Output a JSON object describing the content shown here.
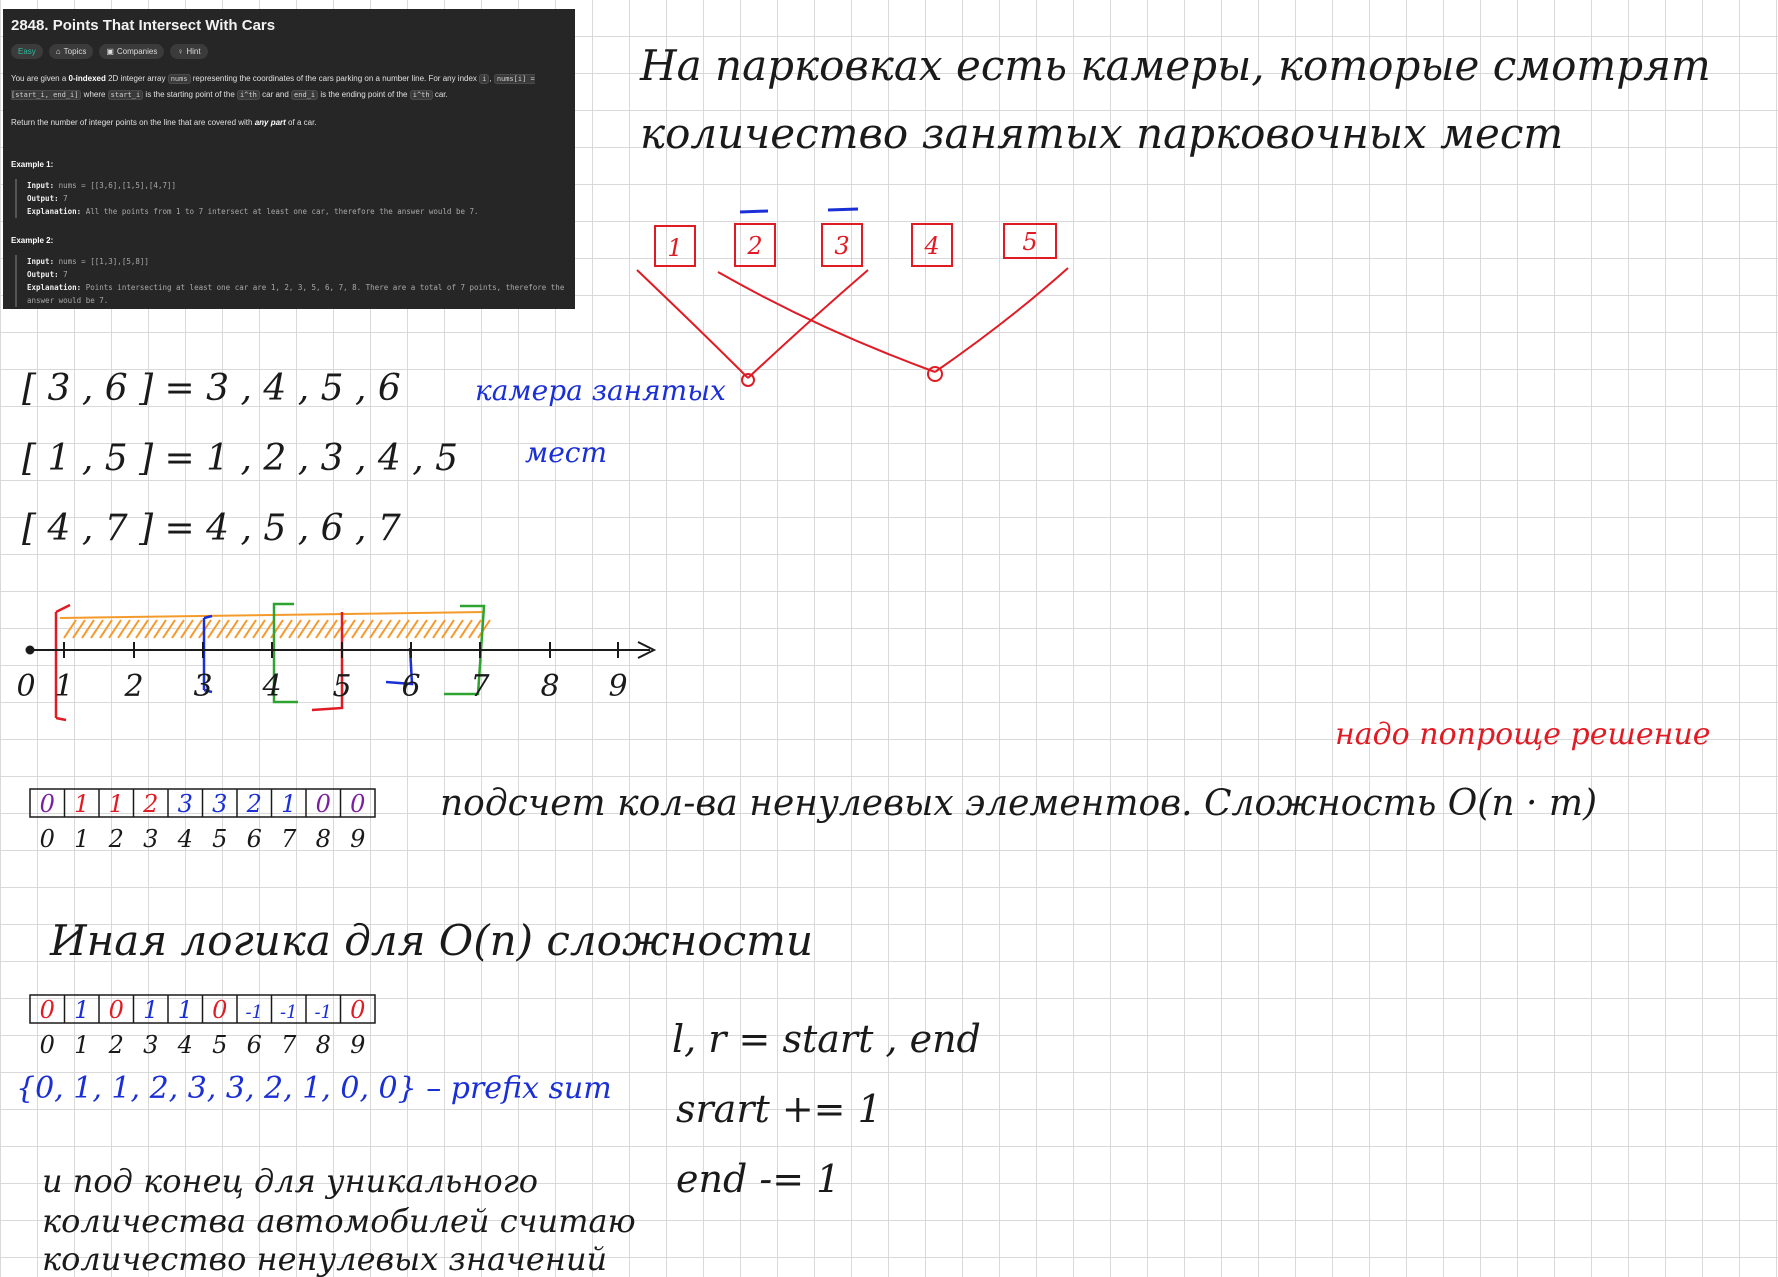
{
  "problem": {
    "title": "2848. Points That Intersect With Cars",
    "tags": [
      "Easy",
      "Topics",
      "Companies",
      "Hint"
    ],
    "desc1_a": "You are given a ",
    "desc1_b": "0-indexed",
    "desc1_c": " 2D integer array ",
    "desc1_code": "nums",
    "desc1_d": " representing the coordinates of the cars parking on a number line. For any index ",
    "desc1_i": "i",
    "desc1_code2": "nums[i] = [start_i, end_i]",
    "desc1_e": " where ",
    "desc1_code3": "start_i",
    "desc1_f": " is the starting point of the ",
    "desc1_code4": "i^th",
    "desc1_g": " car and ",
    "desc1_code5": "end_i",
    "desc1_h": " is the ending point of the ",
    "desc1_code6": "i^th",
    "desc1_j": " car.",
    "desc2_a": "Return the number of integer points on the line that are covered with ",
    "desc2_b": "any part",
    "desc2_c": " of a car.",
    "ex1_title": "Example 1:",
    "ex1_input_label": "Input:",
    "ex1_input": " nums = [[3,6],[1,5],[4,7]]",
    "ex1_output_label": "Output:",
    "ex1_output": " 7",
    "ex1_expl_label": "Explanation:",
    "ex1_expl": " All the points from 1 to 7 intersect at least one car, therefore the answer would be 7.",
    "ex2_title": "Example 2:",
    "ex2_input_label": "Input:",
    "ex2_input": " nums = [[1,3],[5,8]]",
    "ex2_output_label": "Output:",
    "ex2_output": " 7",
    "ex2_expl_label": "Explanation:",
    "ex2_expl": " Points intersecting at least one car are 1, 2, 3, 5, 6, 7, 8. There are a total of 7 points, therefore the answer would be 7."
  },
  "notes": {
    "line1": "На парковках есть камеры, которые смотрят",
    "line2": "количество занятых парковочных мест",
    "cars": [
      "1",
      "2",
      "3",
      "4",
      "5"
    ],
    "range1": "[ 3 , 6 ] = 3 , 4 , 5 , 6",
    "range2": "[ 1 , 5 ] = 1 , 2 , 3 , 4 , 5",
    "range3": "[ 4 , 7 ] = 4 , 5 , 6 , 7",
    "camera_label1": "камера занятых",
    "camera_label2": "мест",
    "axis_ticks": [
      "0",
      "1",
      "2",
      "3",
      "4",
      "5",
      "6",
      "7",
      "8",
      "9"
    ],
    "need_better": "надо попроще решение",
    "count_text": "подсчет кол-ва ненулевых элементов. Сложность O(n · m)",
    "alt_logic": "Иная логика для O(n) сложности",
    "array1": [
      "0",
      "1",
      "1",
      "2",
      "3",
      "3",
      "2",
      "1",
      "0",
      "0"
    ],
    "array1_idx": [
      "0",
      "1",
      "2",
      "3",
      "4",
      "5",
      "6",
      "7",
      "8",
      "9"
    ],
    "array2": [
      "0",
      "1",
      "0",
      "1",
      "1",
      "0",
      "-1",
      "-1",
      "-1",
      "0"
    ],
    "array2_idx": [
      "0",
      "1",
      "2",
      "3",
      "4",
      "5",
      "6",
      "7",
      "8",
      "9"
    ],
    "prefix": "{0, 1, 1, 2, 3, 3, 2, 1, 0, 0} – prefix sum",
    "lr": "l, r = start , end",
    "start_inc": "srart += 1",
    "end_dec": "end -= 1",
    "bottom1": "и под конец для уникального",
    "bottom2": "количества автомобилей считаю",
    "bottom3": "количество ненулевых значений",
    "colors": {
      "red": "#e01b24",
      "blue": "#1a2fd6",
      "green": "#2fa32f",
      "orange": "#f59a2a",
      "purple": "#7b1fa2",
      "ink": "#1a1a1a"
    }
  }
}
